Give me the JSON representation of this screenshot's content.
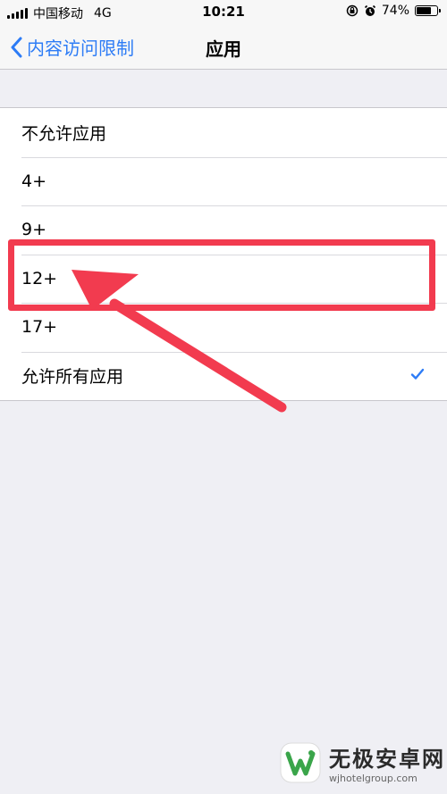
{
  "status_bar": {
    "carrier": "中国移动",
    "network": "4G",
    "time": "10:21",
    "battery_percent": "74%",
    "battery_level": 0.74
  },
  "nav": {
    "back_label": "内容访问限制",
    "title": "应用"
  },
  "list": {
    "items": [
      {
        "label": "不允许应用",
        "checked": false
      },
      {
        "label": "4+",
        "checked": false
      },
      {
        "label": "9+",
        "checked": false
      },
      {
        "label": "12+",
        "checked": false
      },
      {
        "label": "17+",
        "checked": false
      },
      {
        "label": "允许所有应用",
        "checked": true
      }
    ]
  },
  "colors": {
    "accent": "#2d7cf6",
    "annotation": "#f23b4f",
    "background": "#efeff4"
  },
  "watermark": {
    "title": "无极安卓网",
    "url": "wjhotelgroup.com"
  }
}
